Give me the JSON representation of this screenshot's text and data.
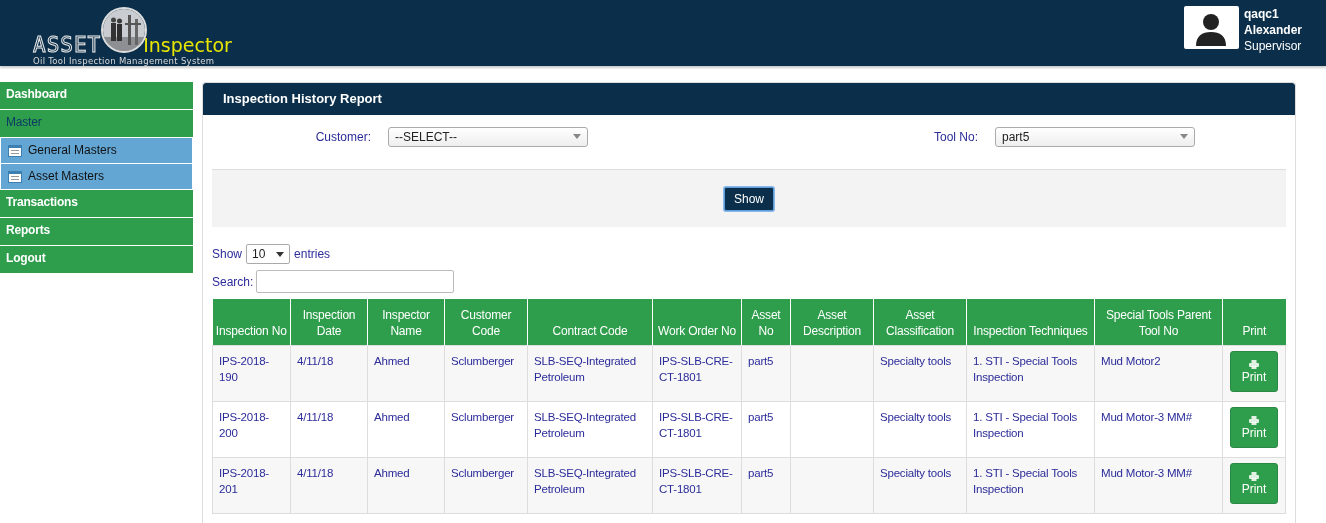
{
  "header": {
    "logo": {
      "word_1": "ASSET",
      "word_2": "Inspector",
      "tagline": "Oil Tool Inspection Management System"
    },
    "user": {
      "username": "qaqc1",
      "name": "Alexander",
      "role": "Supervisor"
    }
  },
  "sidebar": {
    "items": [
      {
        "label": "Dashboard",
        "expanded": false
      },
      {
        "label": "Master",
        "expanded": true,
        "children": [
          {
            "label": "General Masters"
          },
          {
            "label": "Asset Masters"
          }
        ]
      },
      {
        "label": "Transactions",
        "expanded": false
      },
      {
        "label": "Reports",
        "expanded": false
      },
      {
        "label": "Logout",
        "expanded": false
      }
    ]
  },
  "panel": {
    "title": "Inspection History Report",
    "filters": [
      {
        "label": "Customer:",
        "value": "--SELECT--"
      },
      {
        "label": "Tool No:",
        "value": "part5"
      }
    ],
    "show_button": "Show",
    "length": {
      "prefix": "Show",
      "value": "10",
      "suffix": "entries"
    },
    "search": {
      "label": "Search:"
    },
    "table": {
      "columns": [
        "Inspection No",
        "Inspection Date",
        "Inspector Name",
        "Customer Code",
        "Contract Code",
        "Work Order No",
        "Asset No",
        "Asset Description",
        "Asset Classification",
        "Inspection Techniques",
        "Special Tools Parent Tool No",
        "Print"
      ],
      "rows": [
        {
          "cells": [
            "IPS-2018-190",
            "4/11/18",
            "Ahmed",
            "Sclumberger",
            "SLB-SEQ-Integrated Petroleum",
            "IPS-SLB-CRE-CT-1801",
            "part5",
            "",
            "Specialty tools",
            "1. STI - Special Tools Inspection",
            "Mud Motor2"
          ],
          "print": "Print"
        },
        {
          "cells": [
            "IPS-2018-200",
            "4/11/18",
            "Ahmed",
            "Sclumberger",
            "SLB-SEQ-Integrated Petroleum",
            "IPS-SLB-CRE-CT-1801",
            "part5",
            "",
            "Specialty tools",
            "1. STI - Special Tools Inspection",
            "Mud Motor-3 MM#"
          ],
          "print": "Print"
        },
        {
          "cells": [
            "IPS-2018-201",
            "4/11/18",
            "Ahmed",
            "Sclumberger",
            "SLB-SEQ-Integrated Petroleum",
            "IPS-SLB-CRE-CT-1801",
            "part5",
            "",
            "Specialty tools",
            "1. STI - Special Tools Inspection",
            "Mud Motor-3 MM#"
          ],
          "print": "Print"
        }
      ]
    }
  }
}
